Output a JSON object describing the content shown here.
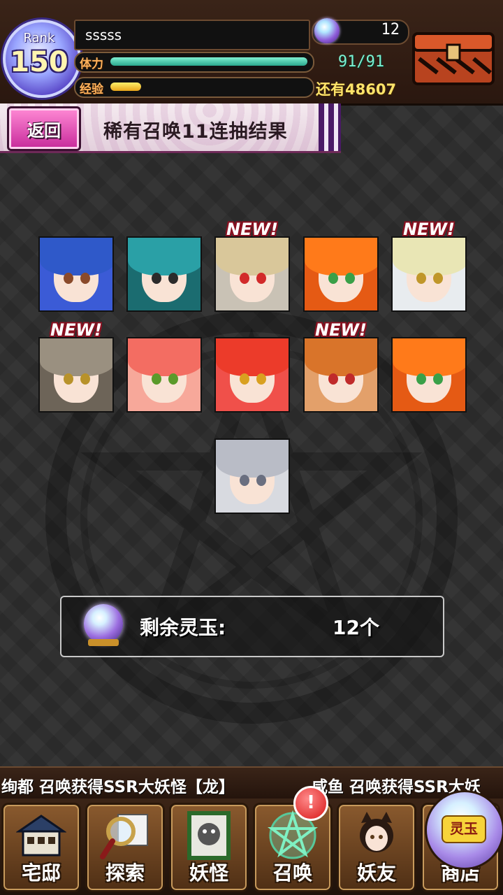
{
  "player": {
    "rank_label": "Rank",
    "rank_value": "150",
    "name": "sssss",
    "hp_label": "体力",
    "hp_value": "91/91",
    "hp_fraction": 1.0,
    "xp_label": "经验",
    "xp_fraction": 0.15,
    "xp_remaining": "还有48607",
    "orb_count": "12"
  },
  "header": {
    "back_label": "返回",
    "title": "稀有召唤11连抽结果"
  },
  "results": {
    "new_label": "NEW!",
    "cards": [
      {
        "new": false,
        "hair": "#2f59c9",
        "eye": "#8a4a2a",
        "bg": "#3b5bd6"
      },
      {
        "new": false,
        "hair": "#2aa0a6",
        "eye": "#2b2b2b",
        "bg": "#1b6c70"
      },
      {
        "new": true,
        "hair": "#d9c79a",
        "eye": "#d22a2a",
        "bg": "#c9c2b5"
      },
      {
        "new": false,
        "hair": "#ff7a1a",
        "eye": "#3aa048",
        "bg": "#e55a14"
      },
      {
        "new": true,
        "hair": "#e9e6b5",
        "eye": "#c0972a",
        "bg": "#e8ecef"
      },
      {
        "new": true,
        "hair": "#9a9080",
        "eye": "#b8922a",
        "bg": "#6d6458"
      },
      {
        "new": false,
        "hair": "#f36d62",
        "eye": "#5a9a2a",
        "bg": "#f7a89a"
      },
      {
        "new": false,
        "hair": "#ec3b2a",
        "eye": "#d9a020",
        "bg": "#f0504a"
      },
      {
        "new": true,
        "hair": "#d9742a",
        "eye": "#c02a2a",
        "bg": "#e3a06a"
      },
      {
        "new": false,
        "hair": "#ff7a1a",
        "eye": "#3aa048",
        "bg": "#e55a14"
      },
      {
        "new": false,
        "hair": "#b9bcc6",
        "eye": "#6a6f80",
        "bg": "#d8dae0"
      }
    ]
  },
  "orb_panel": {
    "label": "剩余灵玉:",
    "value": "12个"
  },
  "ticker": {
    "message1": "绚都 召唤获得SSR大妖怪【龙】",
    "message2": "咸鱼 召唤获得SSR大妖"
  },
  "nav": {
    "items": [
      {
        "label": "宅邸",
        "icon": "house-icon"
      },
      {
        "label": "探索",
        "icon": "magnifier-map-icon"
      },
      {
        "label": "妖怪",
        "icon": "scroll-monster-icon"
      },
      {
        "label": "召唤",
        "icon": "pentagram-icon"
      },
      {
        "label": "妖友",
        "icon": "catgirl-friend-icon"
      },
      {
        "label": "商店",
        "icon": "orb-shop-icon"
      }
    ],
    "alert": "!",
    "shop_orb_label": "灵玉"
  },
  "colors": {
    "accent_pink": "#c7299a",
    "hp_bar": "#2aa88e",
    "xp_bar": "#e8a51a",
    "new_tag": "#8a1020"
  }
}
